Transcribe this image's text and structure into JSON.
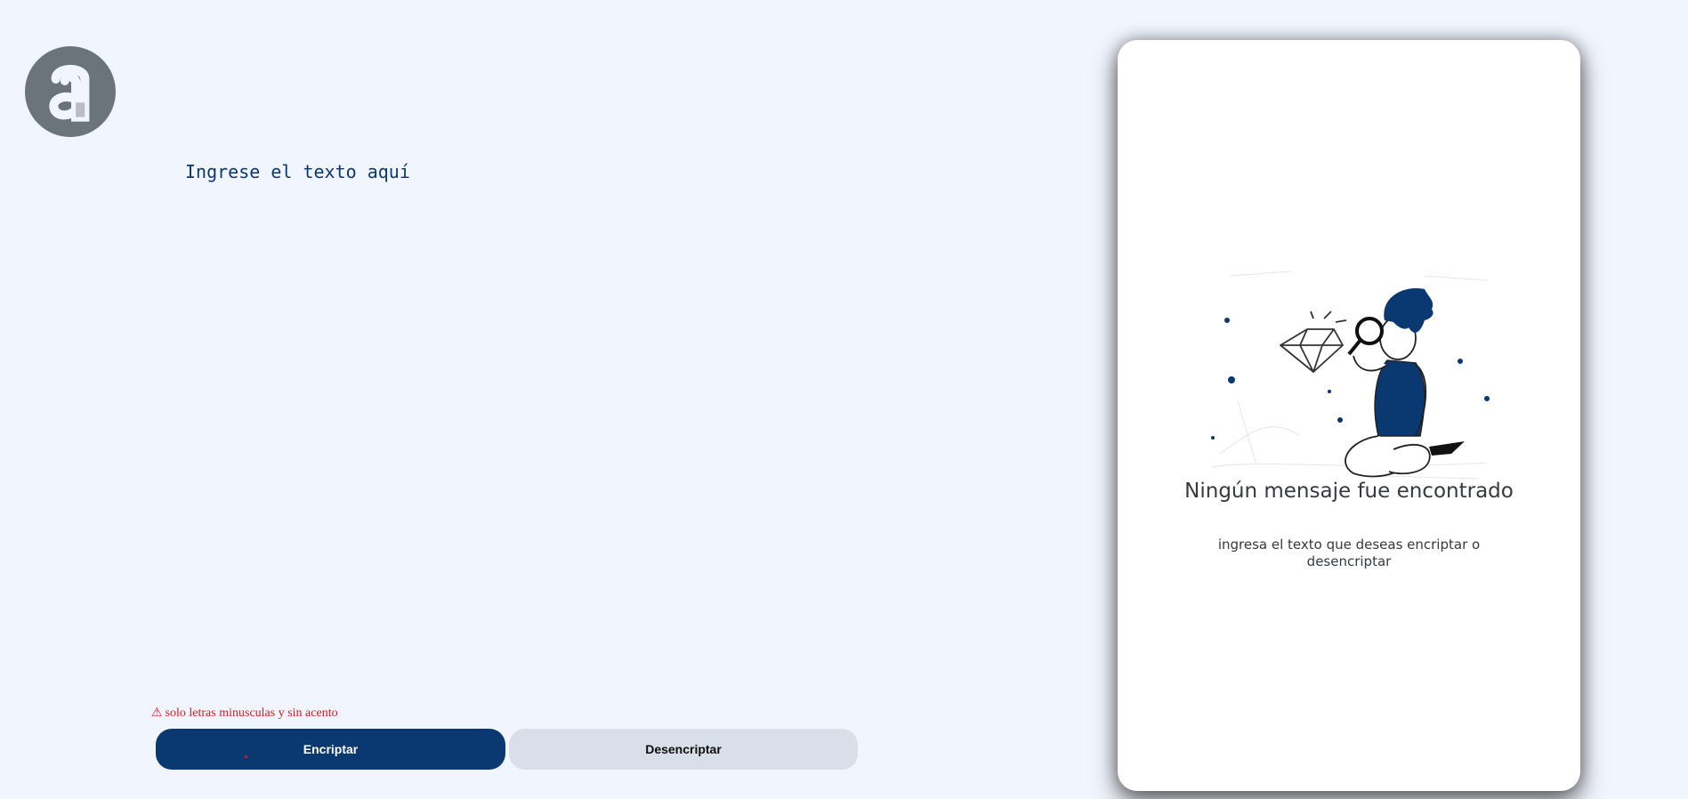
{
  "logo": {
    "icon": "alura-logo-icon",
    "color": "#6b747b"
  },
  "input": {
    "placeholder": "Ingrese el texto aquí",
    "value": ""
  },
  "warning": {
    "icon": "warning-icon",
    "text": "solo letras minusculas y sin acento",
    "color": "#d81b1b"
  },
  "buttons": {
    "encrypt_label": "Encriptar",
    "decrypt_label": "Desencriptar",
    "encrypt_color": "#0a3871",
    "decrypt_color": "#d8dfe8"
  },
  "output": {
    "illustration": "person-with-magnifier-illustration",
    "title": "Ningún mensaje fue encontrado",
    "subtitle": "ingresa el texto que deseas encriptar o desencriptar"
  },
  "colors": {
    "background": "#f1f5fd",
    "accent": "#0a3871"
  }
}
